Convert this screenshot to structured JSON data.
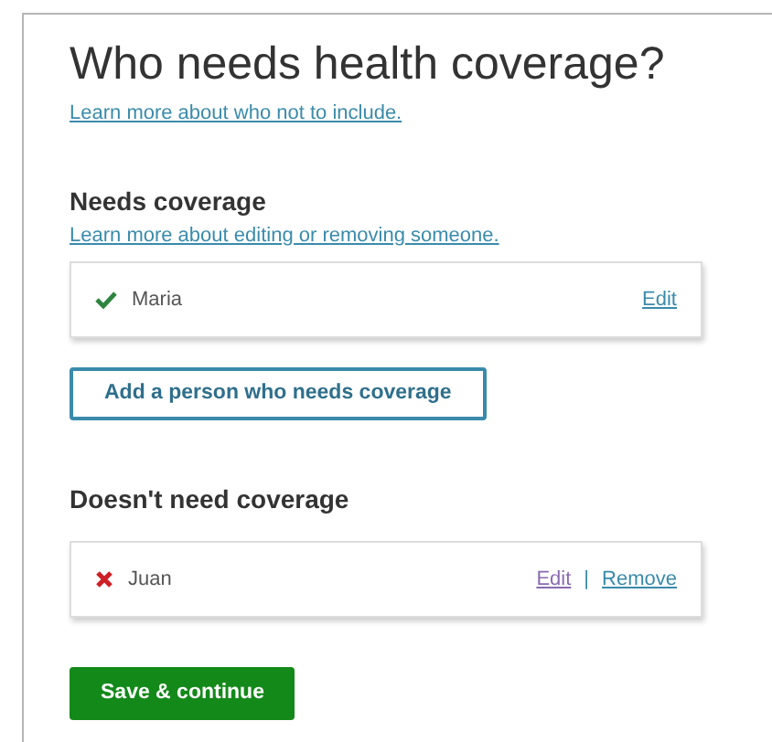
{
  "title": "Who needs health coverage?",
  "intro_link": "Learn more about who not to include.",
  "sections": [
    {
      "heading": "Needs coverage",
      "link": "Learn more about editing or removing someone.",
      "people": [
        {
          "name": "Maria",
          "kind": "covered",
          "actions": [
            {
              "label": "Edit",
              "visited": false
            }
          ]
        }
      ],
      "add_button": "Add a person who needs coverage"
    },
    {
      "heading": "Doesn't need coverage",
      "people": [
        {
          "name": "Juan",
          "kind": "not_covered",
          "actions": [
            {
              "label": "Edit",
              "visited": true
            },
            {
              "label": "Remove",
              "visited": false
            }
          ]
        }
      ],
      "separator": "|"
    }
  ],
  "submit_button": "Save & continue"
}
